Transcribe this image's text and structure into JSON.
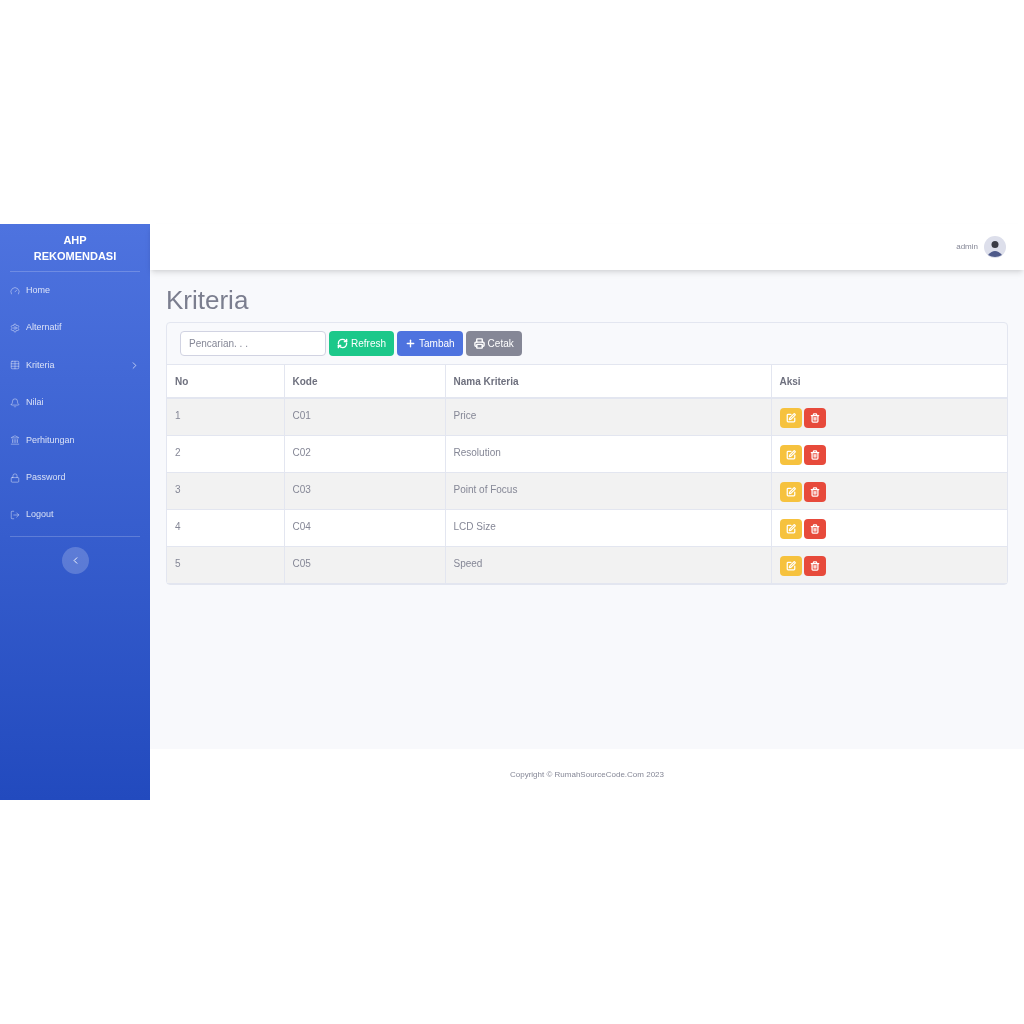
{
  "sidebar": {
    "brand": [
      "AHP",
      "REKOMENDASI"
    ],
    "items": [
      {
        "label": "Home",
        "has_submenu": false
      },
      {
        "label": "Alternatif",
        "has_submenu": false
      },
      {
        "label": "Kriteria",
        "has_submenu": true
      },
      {
        "label": "Nilai",
        "has_submenu": false
      },
      {
        "label": "Perhitungan",
        "has_submenu": false
      },
      {
        "label": "Password",
        "has_submenu": false
      },
      {
        "label": "Logout",
        "has_submenu": false
      }
    ]
  },
  "topbar": {
    "user": "admin"
  },
  "page_title": "Kriteria",
  "toolbar": {
    "search": {
      "placeholder": "Pencarian. . ."
    },
    "buttons": [
      {
        "label": "Refresh",
        "kind": "refresh"
      },
      {
        "label": "Tambah",
        "kind": "add"
      },
      {
        "label": "Cetak",
        "kind": "print"
      }
    ]
  },
  "table": {
    "columns": [
      "No",
      "Kode",
      "Nama Kriteria",
      "Aksi"
    ],
    "rows": [
      {
        "no": "1",
        "kode": "C01",
        "nama": "Price"
      },
      {
        "no": "2",
        "kode": "C02",
        "nama": "Resolution"
      },
      {
        "no": "3",
        "kode": "C03",
        "nama": "Point of Focus"
      },
      {
        "no": "4",
        "kode": "C04",
        "nama": "LCD Size"
      },
      {
        "no": "5",
        "kode": "C05",
        "nama": "Speed"
      }
    ]
  },
  "footer": "Copyright © RumahSourceCode.Com 2023"
}
